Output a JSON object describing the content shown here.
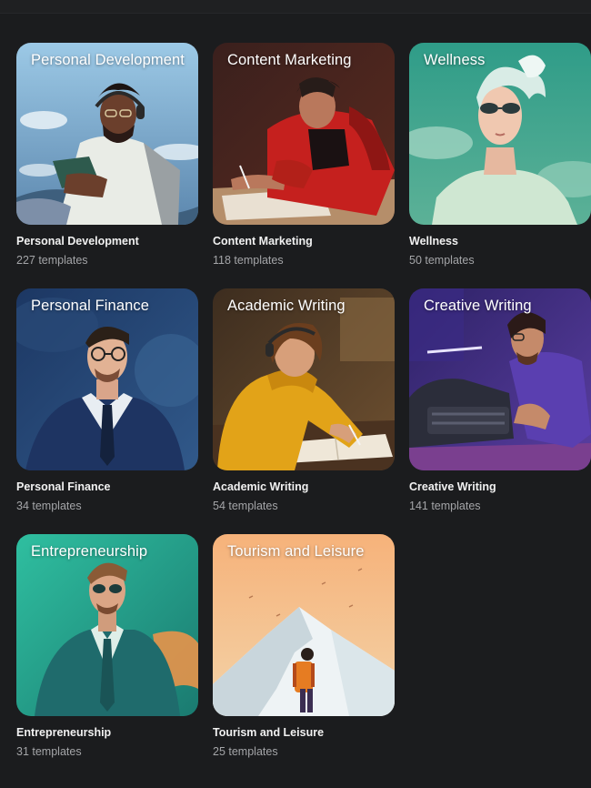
{
  "categories": [
    {
      "title": "Personal Development",
      "name": "Personal Development",
      "count": "227 templates",
      "colors": {
        "bg_top": "#8fbfe0",
        "bg_bottom": "#5e88b0",
        "accent": "#e8ece8"
      }
    },
    {
      "title": "Content Marketing",
      "name": "Content Marketing",
      "count": "118 templates",
      "colors": {
        "bg_top": "#3a1e1c",
        "bg_bottom": "#7a2a1e",
        "accent": "#c8221f"
      }
    },
    {
      "title": "Wellness",
      "name": "Wellness",
      "count": "50 templates",
      "colors": {
        "bg_top": "#2e9a86",
        "bg_bottom": "#67b59c",
        "accent": "#cfe7d4"
      }
    },
    {
      "title": "Personal Finance",
      "name": "Personal Finance",
      "count": "34 templates",
      "colors": {
        "bg_top": "#1f3a66",
        "bg_bottom": "#2c5788",
        "accent": "#223a6a"
      }
    },
    {
      "title": "Academic Writing",
      "name": "Academic Writing",
      "count": "54 templates",
      "colors": {
        "bg_top": "#3a2c1e",
        "bg_bottom": "#6b4a25",
        "accent": "#e4a316"
      }
    },
    {
      "title": "Creative Writing",
      "name": "Creative Writing",
      "count": "141 templates",
      "colors": {
        "bg_top": "#3a2a7a",
        "bg_bottom": "#5a3ea0",
        "accent": "#6a4bb8"
      }
    },
    {
      "title": "Entrepreneurship",
      "name": "Entrepreneurship",
      "count": "31 templates",
      "colors": {
        "bg_top": "#2bb59a",
        "bg_bottom": "#1f7f72",
        "accent": "#1e6c6a"
      }
    },
    {
      "title": "Tourism and Leisure",
      "name": "Tourism and Leisure",
      "count": "25 templates",
      "colors": {
        "bg_top": "#f6b77a",
        "bg_bottom": "#f1cfa3",
        "accent": "#e8eef2"
      }
    }
  ]
}
